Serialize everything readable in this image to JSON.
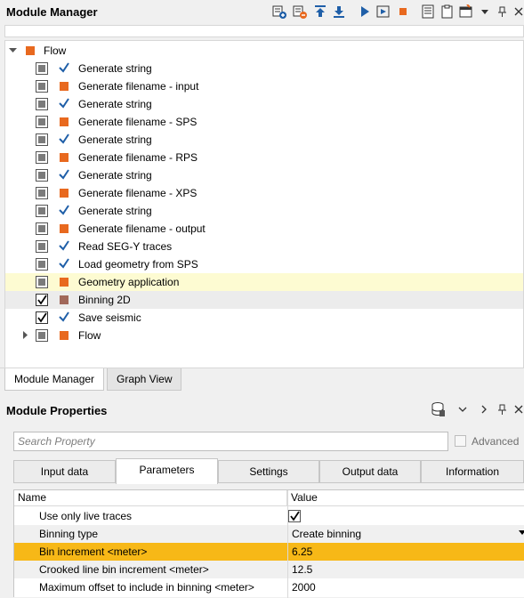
{
  "module_manager": {
    "title": "Module Manager",
    "toolbar_icons": [
      "add-module-icon",
      "remove-module-icon",
      "move-up-icon",
      "move-down-icon",
      "run-icon",
      "run-step-icon",
      "stop-icon",
      "log-icon",
      "clipboard-icon",
      "window-menu-icon",
      "dropdown-icon",
      "pin-icon",
      "close-icon"
    ]
  },
  "tree": {
    "root_label": "Flow",
    "items": [
      {
        "label": "Generate string",
        "check": "gray",
        "status": "ok"
      },
      {
        "label": "Generate filename - input",
        "check": "gray",
        "status": "pending"
      },
      {
        "label": "Generate string",
        "check": "gray",
        "status": "ok"
      },
      {
        "label": "Generate filename - SPS",
        "check": "gray",
        "status": "pending"
      },
      {
        "label": "Generate string",
        "check": "gray",
        "status": "ok"
      },
      {
        "label": "Generate filename - RPS",
        "check": "gray",
        "status": "pending"
      },
      {
        "label": "Generate string",
        "check": "gray",
        "status": "ok"
      },
      {
        "label": "Generate filename - XPS",
        "check": "gray",
        "status": "pending"
      },
      {
        "label": "Generate string",
        "check": "gray",
        "status": "ok"
      },
      {
        "label": "Generate filename - output",
        "check": "gray",
        "status": "pending"
      },
      {
        "label": "Read SEG-Y traces",
        "check": "gray",
        "status": "ok"
      },
      {
        "label": "Load geometry from SPS",
        "check": "gray",
        "status": "ok"
      },
      {
        "label": "Geometry application",
        "check": "gray",
        "status": "pending"
      },
      {
        "label": "Binning 2D",
        "check": "checked",
        "status": "selected"
      },
      {
        "label": "Save seismic",
        "check": "checked",
        "status": "ok"
      },
      {
        "label": "Flow",
        "check": "gray",
        "status": "pending"
      }
    ]
  },
  "bottom_tabs": {
    "module_manager": "Module Manager",
    "graph_view": "Graph View"
  },
  "module_properties": {
    "title": "Module Properties",
    "search_placeholder": "Search Property",
    "advanced_label": "Advanced",
    "tabs": [
      "Input data",
      "Parameters",
      "Settings",
      "Output data",
      "Information"
    ],
    "active_tab": "Parameters",
    "columns": {
      "name": "Name",
      "value": "Value"
    },
    "rows": [
      {
        "name": "Use only live traces",
        "value": ""
      },
      {
        "name": "Binning type",
        "value": "Create binning"
      },
      {
        "name": "Bin increment <meter>",
        "value": "6.25"
      },
      {
        "name": "Crooked line bin increment <meter>",
        "value": "12.5"
      },
      {
        "name": "Maximum offset to include in binning <meter>",
        "value": "2000"
      }
    ]
  },
  "colors": {
    "accent_orange": "#e8691f",
    "check_blue": "#1f5fa8",
    "selected_row": "#f7b817",
    "highlight_yellow": "#fdfbd2"
  }
}
